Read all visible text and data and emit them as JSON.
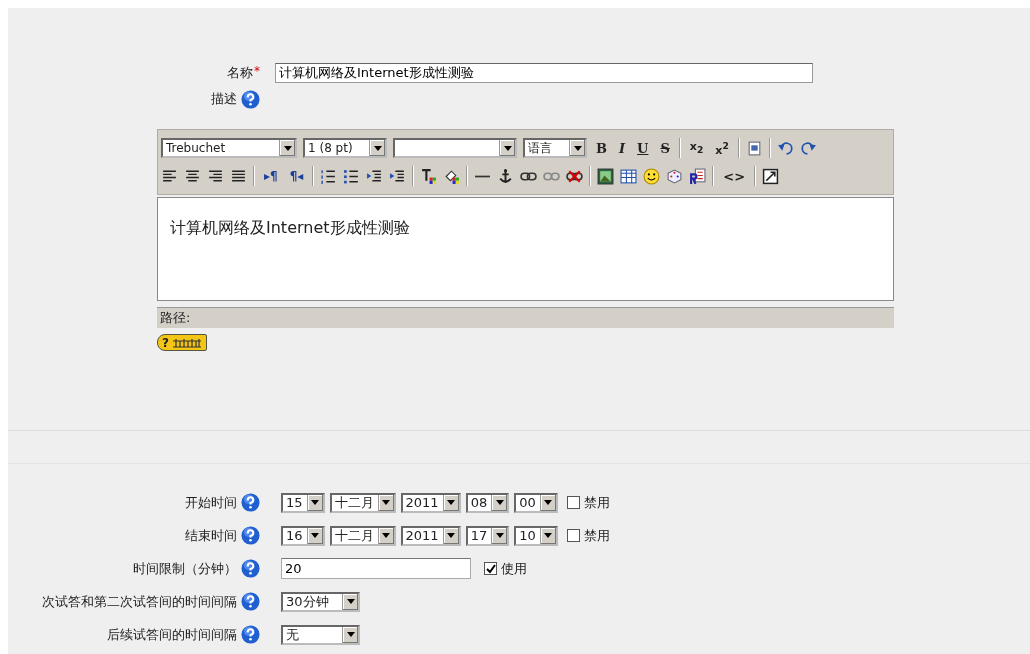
{
  "name_field": {
    "label": "名称",
    "required_mark": "*",
    "value": "计算机网络及Internet形成性测验"
  },
  "description": {
    "label": "描述"
  },
  "editor": {
    "font": "Trebuchet",
    "size": "1 (8 pt)",
    "language": "语言",
    "toolbar_rows": [
      [
        [
          {
            "kind": "bold",
            "label": "B"
          },
          {
            "kind": "italic",
            "label": "I"
          },
          {
            "kind": "underline",
            "label": "U"
          },
          {
            "kind": "strike",
            "label": "S"
          }
        ],
        [
          {
            "kind": "subscript",
            "label": "x$_{2}$"
          },
          {
            "kind": "superscript",
            "label": "x$^{2}$"
          }
        ],
        [
          {
            "kind": "paste-word"
          }
        ],
        [
          {
            "kind": "undo"
          },
          {
            "kind": "redo"
          }
        ]
      ],
      [
        [
          {
            "kind": "align-left"
          },
          {
            "kind": "align-center"
          },
          {
            "kind": "align-right"
          },
          {
            "kind": "justify"
          }
        ],
        [
          {
            "kind": "ltr",
            "label": "▸¶"
          },
          {
            "kind": "rtl",
            "label": "¶◂"
          }
        ],
        [
          {
            "kind": "ordered-list"
          },
          {
            "kind": "bullet-list"
          },
          {
            "kind": "outdent"
          },
          {
            "kind": "indent"
          }
        ],
        [
          {
            "kind": "text-color"
          },
          {
            "kind": "highlight"
          }
        ],
        [
          {
            "kind": "rule"
          },
          {
            "kind": "anchor"
          },
          {
            "kind": "link"
          },
          {
            "kind": "unlink"
          },
          {
            "kind": "no-link"
          }
        ],
        [
          {
            "kind": "image"
          },
          {
            "kind": "table"
          },
          {
            "kind": "smiley"
          },
          {
            "kind": "dice"
          },
          {
            "kind": "find-replace"
          }
        ],
        [
          {
            "kind": "html",
            "label": "<>"
          }
        ],
        [
          {
            "kind": "fullscreen"
          }
        ]
      ]
    ],
    "content": "计算机网络及Internet形成性测验",
    "path_label": "路径:",
    "help_badge": "?"
  },
  "timing": [
    {
      "kind": "datetime",
      "label": "开始时间",
      "selects": [
        "15",
        "十二月",
        "2011",
        "08",
        "00"
      ],
      "checkbox": {
        "label": "禁用",
        "checked": false
      }
    },
    {
      "kind": "datetime",
      "label": "结束时间",
      "selects": [
        "16",
        "十二月",
        "2011",
        "17",
        "10"
      ],
      "checkbox": {
        "label": "禁用",
        "checked": false
      }
    },
    {
      "kind": "text",
      "label": "时间限制（分钟）",
      "value": "20",
      "checkbox": {
        "label": "使用",
        "checked": true
      }
    },
    {
      "kind": "select",
      "label": "次试答和第二次试答间的时间间隔",
      "value": "30分钟"
    },
    {
      "kind": "select",
      "label": "后续试答间的时间间隔",
      "value": "无"
    }
  ]
}
